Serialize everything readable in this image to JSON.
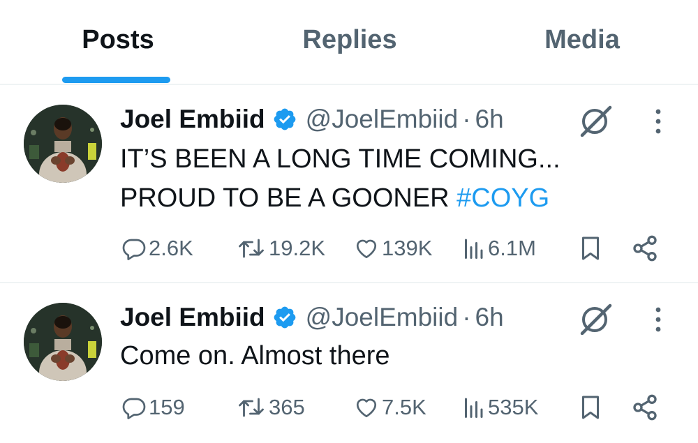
{
  "tabs": [
    {
      "label": "Posts",
      "active": true
    },
    {
      "label": "Replies",
      "active": false
    },
    {
      "label": "Media",
      "active": false
    }
  ],
  "colors": {
    "accent": "#1d9bf0",
    "text": "#0f1419",
    "secondary": "#536471",
    "divider": "#eff3f4"
  },
  "icons": [
    "verified-badge-icon",
    "grok-icon",
    "more-icon",
    "reply-icon",
    "retweet-icon",
    "like-icon",
    "views-icon",
    "bookmark-icon",
    "share-icon"
  ],
  "tweets": [
    {
      "author": "Joel Embiid",
      "handle": "@JoelEmbiid",
      "separator": "·",
      "time": "6h",
      "text_line1": "IT’S BEEN A LONG TIME COMING...",
      "text_line2_plain": "PROUD TO BE A GOONER ",
      "text_line2_hashtag": "#COYG",
      "replies": "2.6K",
      "reposts": "19.2K",
      "likes": "139K",
      "views": "6.1M"
    },
    {
      "author": "Joel Embiid",
      "handle": "@JoelEmbiid",
      "separator": "·",
      "time": "6h",
      "text_line1": "Come on. Almost there",
      "replies": "159",
      "reposts": "365",
      "likes": "7.5K",
      "views": "535K"
    }
  ]
}
